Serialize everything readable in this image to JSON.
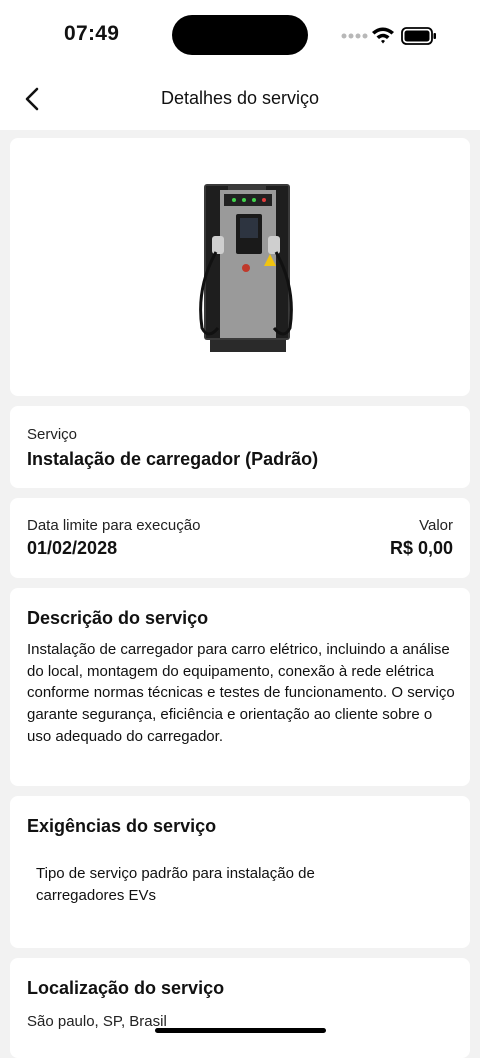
{
  "status_bar": {
    "time": "07:49"
  },
  "nav": {
    "title": "Detalhes do serviço",
    "back_icon": "chevron-left-icon"
  },
  "service": {
    "label": "Serviço",
    "name": "Instalação de carregador (Padrão)"
  },
  "deadline": {
    "label": "Data limite para execução",
    "date": "01/02/2028",
    "value_label": "Valor",
    "value": "R$ 0,00"
  },
  "description": {
    "title": "Descrição do serviço",
    "text": "Instalação de carregador para carro elétrico, incluindo a análise do local, montagem do equipamento, conexão à rede elétrica conforme normas técnicas e testes de funcionamento. O serviço garante segurança, eficiência e orientação ao cliente sobre o uso adequado do carregador."
  },
  "requirements": {
    "title": "Exigências do serviço",
    "text": "Tipo de serviço padrão para instalação de carregadores EVs"
  },
  "location": {
    "title": "Localização do serviço",
    "address": "São paulo, SP, Brasil"
  }
}
